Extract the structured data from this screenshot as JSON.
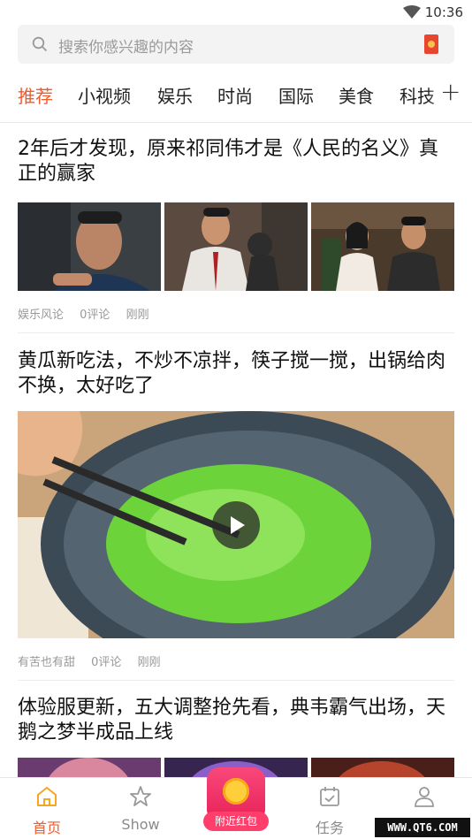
{
  "status_bar": {
    "time": "10:36"
  },
  "search": {
    "placeholder": "搜索你感兴趣的内容"
  },
  "tabs": [
    "推荐",
    "小视频",
    "娱乐",
    "时尚",
    "国际",
    "美食",
    "科技"
  ],
  "tabs_add": "+",
  "articles": [
    {
      "title": "2年后才发现，原来祁同伟才是《人民的名义》真正的赢家",
      "source": "娱乐风论",
      "comments": "0评论",
      "time": "刚刚"
    },
    {
      "title": "黄瓜新吃法，不炒不凉拌，筷子搅一搅，出锅给肉不换，太好吃了",
      "source": "有苦也有甜",
      "comments": "0评论",
      "time": "刚刚"
    },
    {
      "title": "体验服更新，五大调整抢先看，典韦霸气出场，天鹅之梦半成品上线"
    }
  ],
  "bottom_nav": {
    "home": "首页",
    "show": "Show",
    "nearby": "附近红包",
    "tasks": "任务",
    "mine": "我的"
  },
  "watermark": "WWW.QT6.COM",
  "colors": {
    "accent": "#f25a2c",
    "muted": "#999999"
  }
}
